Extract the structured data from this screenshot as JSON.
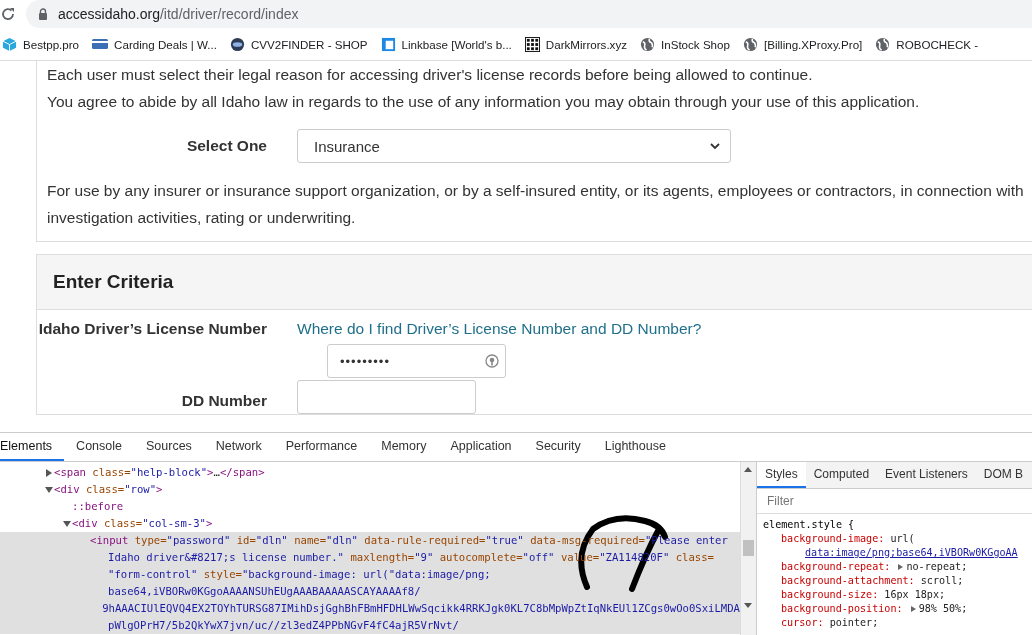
{
  "address_bar": {
    "domain": "accessidaho.org",
    "path": "/itd/driver/record/index"
  },
  "bookmarks": [
    {
      "label": "Bestpp.pro",
      "kind": "cube"
    },
    {
      "label": "Carding Deals | W...",
      "kind": "card"
    },
    {
      "label": "CVV2FINDER - SHOP",
      "kind": "disc"
    },
    {
      "label": "Linkbase [World's b...",
      "kind": "window"
    },
    {
      "label": "DarkMirrors.xyz",
      "kind": "grid"
    },
    {
      "label": "InStock Shop",
      "kind": "globe"
    },
    {
      "label": "[Billing.XProxy.Pro]",
      "kind": "globe"
    },
    {
      "label": "ROBOCHECK -",
      "kind": "globe"
    }
  ],
  "page": {
    "intro_lines": [
      "Each user must select their legal reason for accessing driver's license records before being allowed to continue.",
      "You agree to abide by all Idaho law in regards to the use of any information you may obtain through your use of this application."
    ],
    "reason_select": {
      "label": "Select One",
      "value": "Insurance"
    },
    "reason_description": [
      "For use by any insurer or insurance support organization, or by a self-insured entity, or its agents, employees or contractors, in connection with",
      "investigation activities, rating or underwriting."
    ],
    "criteria": {
      "title": "Enter Criteria",
      "license_label": "Idaho Driver’s License Number",
      "help_link": "Where do I find Driver’s License Number and DD Number?",
      "license_value": "•••••••••",
      "dd_label": "DD Number"
    }
  },
  "devtools": {
    "tabs": [
      {
        "label": "Elements",
        "selected": true
      },
      {
        "label": "Console",
        "selected": false
      },
      {
        "label": "Sources",
        "selected": false
      },
      {
        "label": "Network",
        "selected": false
      },
      {
        "label": "Performance",
        "selected": false
      },
      {
        "label": "Memory",
        "selected": false
      },
      {
        "label": "Application",
        "selected": false
      },
      {
        "label": "Security",
        "selected": false
      },
      {
        "label": "Lighthouse",
        "selected": false
      }
    ],
    "dom_tree": [
      {
        "expanded": false,
        "selected": false,
        "lines": [
          [
            {
              "kind": "tag",
              "text": "<span"
            },
            {
              "kind": "attr",
              "text": " class="
            },
            {
              "kind": "value",
              "text": "\"help-block\""
            },
            {
              "kind": "tag",
              "text": ">"
            },
            {
              "kind": "text",
              "text": "…"
            },
            {
              "kind": "tag",
              "text": "</span>"
            }
          ]
        ]
      },
      {
        "expanded": true,
        "selected": false,
        "lines": [
          [
            {
              "kind": "tag",
              "text": "<div"
            },
            {
              "kind": "attr",
              "text": " class="
            },
            {
              "kind": "value",
              "text": "\"row\""
            },
            {
              "kind": "tag",
              "text": ">"
            }
          ]
        ],
        "children": [
          {
            "selected": false,
            "lines": [
              [
                {
                  "kind": "pseudo",
                  "text": "::before"
                }
              ]
            ]
          },
          {
            "expanded": true,
            "selected": false,
            "lines": [
              [
                {
                  "kind": "tag",
                  "text": "<div"
                },
                {
                  "kind": "attr",
                  "text": " class="
                },
                {
                  "kind": "value",
                  "text": "\"col-sm-3\""
                },
                {
                  "kind": "tag",
                  "text": ">"
                }
              ]
            ],
            "children": [
              {
                "selected": true,
                "lines": [
                  [
                    {
                      "kind": "tag",
                      "text": "<input"
                    },
                    {
                      "kind": "attr",
                      "text": " type="
                    },
                    {
                      "kind": "value",
                      "text": "\"password\""
                    },
                    {
                      "kind": "attr",
                      "text": " id="
                    },
                    {
                      "kind": "value",
                      "text": "\"dln\""
                    },
                    {
                      "kind": "attr",
                      "text": " name="
                    },
                    {
                      "kind": "value",
                      "text": "\"dln\""
                    },
                    {
                      "kind": "attr",
                      "text": " data-rule-required="
                    },
                    {
                      "kind": "value",
                      "text": "\"true\""
                    },
                    {
                      "kind": "attr",
                      "text": " data-msg-required="
                    },
                    {
                      "kind": "value",
                      "text": "\"Please enter"
                    }
                  ],
                  [
                    {
                      "kind": "value",
                      "text": "Idaho driver&#8217;s license number.\""
                    },
                    {
                      "kind": "attr",
                      "text": " maxlength="
                    },
                    {
                      "kind": "value",
                      "text": "\"9\""
                    },
                    {
                      "kind": "attr",
                      "text": " autocomplete="
                    },
                    {
                      "kind": "value",
                      "text": "\"off\""
                    },
                    {
                      "kind": "attr",
                      "text": " value="
                    },
                    {
                      "kind": "value",
                      "text": "\"ZA114820F\""
                    },
                    {
                      "kind": "attr",
                      "text": " class="
                    }
                  ],
                  [
                    {
                      "kind": "value",
                      "text": "\"form-control\""
                    },
                    {
                      "kind": "attr",
                      "text": " style="
                    },
                    {
                      "kind": "value",
                      "text": "\"background-image: url(\"data:image/png;"
                    }
                  ],
                  [
                    {
                      "kind": "value",
                      "text": "base64,iVBORw0KGgoAAAANSUhEUgAAABAAAAASCAYAAAAf8/"
                    }
                  ],
                  [
                    {
                      "kind": "value",
                      "text": "9hAAACIUlEQVQ4EX2TOYhTURSG87IMihDsjGghBhFBmHFDHLWwSqcikk4RRKJgk0KL7C8bMpWpZtIqNkEUl1ZCgs0wOo0SxiLMDA"
                    }
                  ],
                  [
                    {
                      "kind": "value",
                      "text": "pWlgOPrH7/5b2QkYwX7jvn/uc//zl3edZ4PPbNGvF4fC4ajR5VrNvt/"
                    }
                  ]
                ]
              }
            ]
          }
        ]
      }
    ],
    "styles_tabs": [
      {
        "label": "Styles",
        "selected": true
      },
      {
        "label": "Computed",
        "selected": false
      },
      {
        "label": "Event Listeners",
        "selected": false
      },
      {
        "label": "DOM B",
        "selected": false
      }
    ],
    "filter": {
      "placeholder": "Filter"
    },
    "rule": {
      "selector": "element.style {",
      "declarations": [
        {
          "property": "background-image:",
          "value": "url(",
          "link": "data:image/png;base64,iVBORw0KGgoAA"
        },
        {
          "property": "background-repeat:",
          "value": "no-repeat;",
          "expander": true
        },
        {
          "property": "background-attachment:",
          "value": "scroll;"
        },
        {
          "property": "background-size:",
          "value": "16px 18px;"
        },
        {
          "property": "background-position:",
          "value": "98% 50%;",
          "expander": true
        },
        {
          "property": "cursor:",
          "value": "pointer;"
        }
      ]
    }
  }
}
